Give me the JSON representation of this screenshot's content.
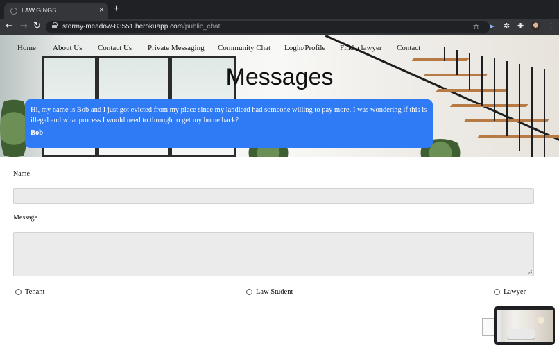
{
  "browser": {
    "tab_title": "LAW.GINGS",
    "tab_close": "×",
    "new_tab": "+",
    "back": "←",
    "forward": "→",
    "reload": "↻",
    "url_host": "stormy-meadow-83551.herokuapp.com",
    "url_path": "/public_chat",
    "bookmark": "☆",
    "menu": "⋮",
    "extensions": [
      "▸",
      "✲",
      "✚"
    ]
  },
  "nav": {
    "items": [
      "Home",
      "About Us",
      "Contact Us",
      "Private Messaging",
      "Community Chat",
      "Login/Profile",
      "Find a lawyer",
      "Contact"
    ]
  },
  "page": {
    "title": "Messages"
  },
  "message": {
    "body": "Hi, my name is Bob and I just got evicted from my place since my landlord had someone willing to pay more. I was wondering if this is illegal and what process I would need to through to get my home back?",
    "author": "Bob",
    "bubble_color": "#2f7bf5"
  },
  "form": {
    "name_label": "Name",
    "name_value": "",
    "message_label": "Message",
    "message_value": "",
    "roles": [
      "Tenant",
      "Law Student",
      "Lawyer"
    ]
  }
}
